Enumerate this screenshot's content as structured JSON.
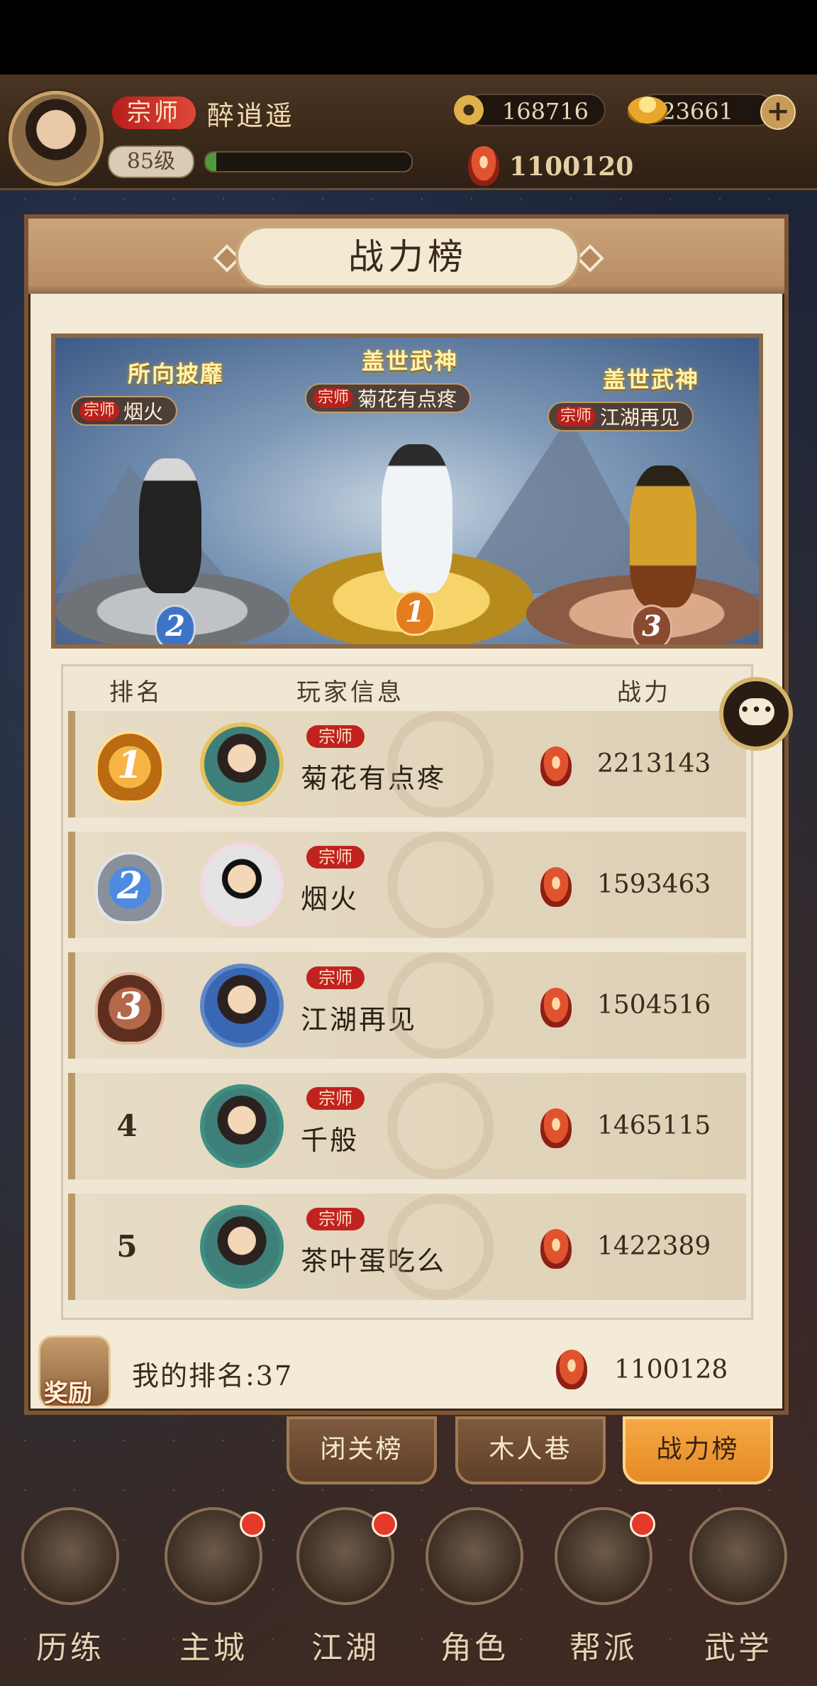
{
  "player": {
    "title": "宗师",
    "name": "醉逍遥",
    "level": "85级",
    "exp_fraction": 0.05,
    "coins": "168716",
    "ingots": "23661",
    "power": "1100120"
  },
  "panel": {
    "title": "战力榜"
  },
  "podium": {
    "first": {
      "honor": "盖世武神",
      "title": "宗师",
      "name": "菊花有点疼",
      "rank": "1"
    },
    "second": {
      "honor": "所向披靡",
      "title": "宗师",
      "name": "烟火",
      "rank": "2"
    },
    "third": {
      "honor": "盖世武神",
      "title": "宗师",
      "name": "江湖再见",
      "rank": "3"
    }
  },
  "table": {
    "headers": {
      "rank": "排名",
      "info": "玩家信息",
      "power": "战力"
    },
    "rows": [
      {
        "rank": "1",
        "title": "宗师",
        "name": "菊花有点疼",
        "power": "2213143"
      },
      {
        "rank": "2",
        "title": "宗师",
        "name": "烟火",
        "power": "1593463"
      },
      {
        "rank": "3",
        "title": "宗师",
        "name": "江湖再见",
        "power": "1504516"
      },
      {
        "rank": "4",
        "title": "宗师",
        "name": "千般",
        "power": "1465115"
      },
      {
        "rank": "5",
        "title": "宗师",
        "name": "茶叶蛋吃么",
        "power": "1422389"
      }
    ]
  },
  "my_rank": {
    "reward_label": "奖励",
    "rank_text": "我的排名:37",
    "power": "1100128"
  },
  "tabs": [
    "闭关榜",
    "木人巷",
    "战力榜"
  ],
  "active_tab": "战力榜",
  "nav": [
    "历练",
    "主城",
    "江湖",
    "角色",
    "帮派",
    "武学"
  ],
  "colors": {
    "accent": "#e58a25",
    "badge_red": "#c0231f",
    "gold": "#d6b35a"
  }
}
